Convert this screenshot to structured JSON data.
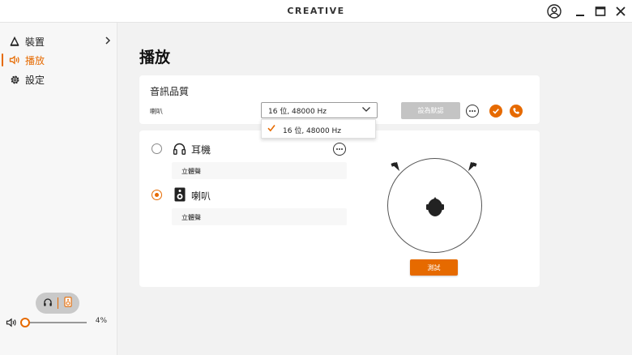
{
  "app": {
    "brand": "CREATIVE"
  },
  "window_controls": [
    "account-icon",
    "minimize-icon",
    "maximize-icon",
    "close-icon"
  ],
  "sidebar": {
    "items": [
      {
        "label": "裝置",
        "icon": "device-triangle-icon",
        "active": false,
        "has_chevron": true
      },
      {
        "label": "播放",
        "icon": "speaker-wave-icon",
        "active": true,
        "has_chevron": false
      },
      {
        "label": "設定",
        "icon": "gear-icon",
        "active": false,
        "has_chevron": false
      }
    ],
    "volume": {
      "percent_label": "4%",
      "level": 0.04
    }
  },
  "main": {
    "title": "播放",
    "audio_quality": {
      "heading": "音訊品質",
      "device_label": "喇叭",
      "selected_format": "16 位, 48000 Hz",
      "dropdown_options": [
        "16 位, 48000 Hz"
      ],
      "default_button": "設為默認"
    },
    "outputs": [
      {
        "label": "耳機",
        "mode": "立體聲",
        "selected": false,
        "icon": "headphones-icon"
      },
      {
        "label": "喇叭",
        "mode": "立體聲",
        "selected": true,
        "icon": "speaker-icon"
      }
    ],
    "test_button": "測試"
  },
  "colors": {
    "accent": "#e66a00",
    "card": "#ffffff",
    "background": "#f2f2f2",
    "disabled_button": "#c4c4c4"
  }
}
